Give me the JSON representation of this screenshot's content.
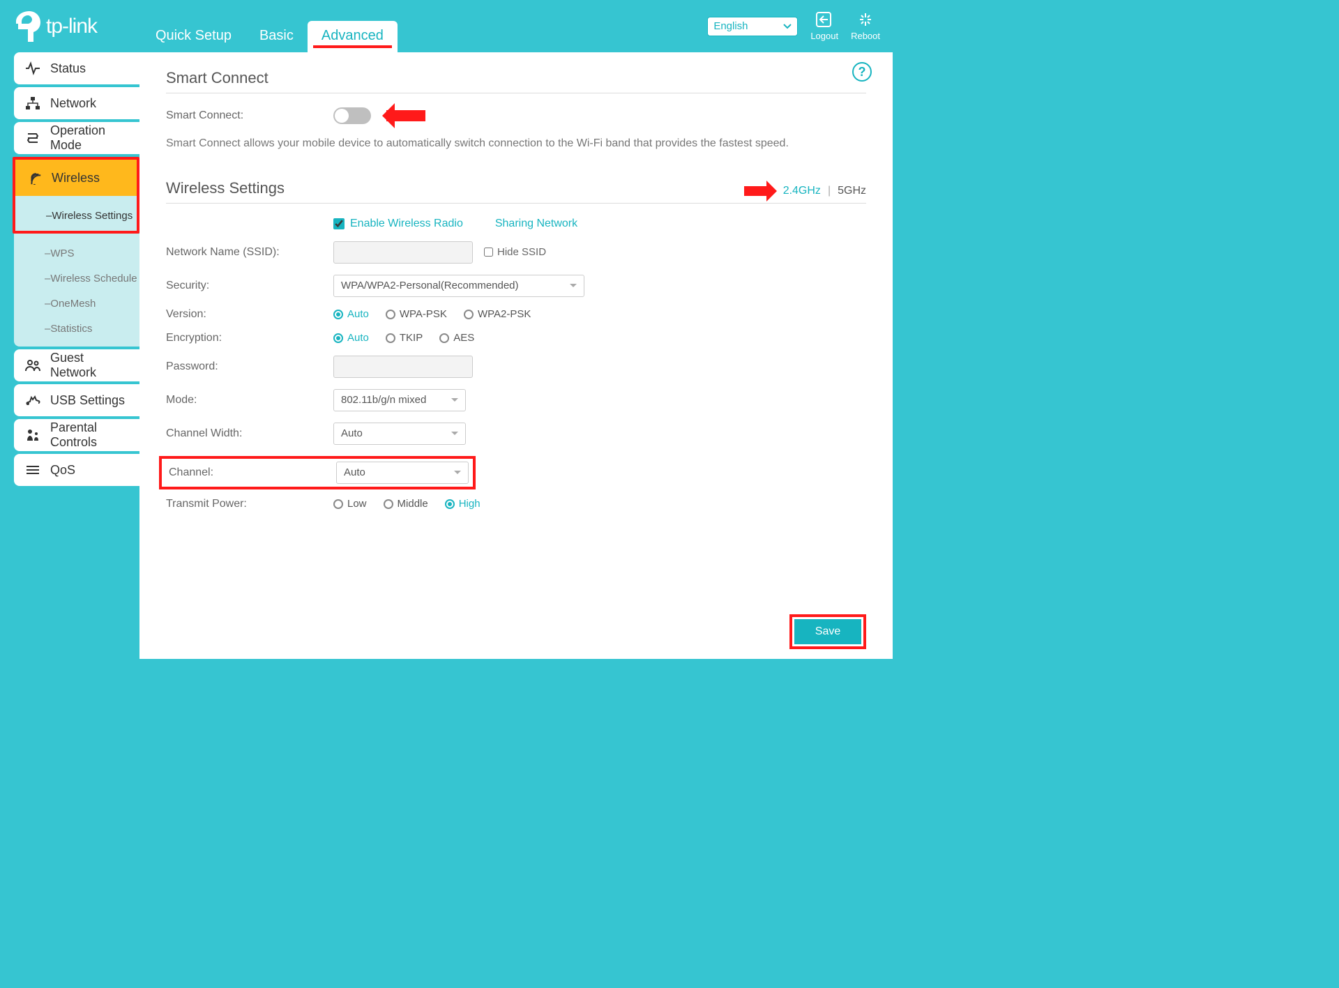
{
  "brand": "tp-link",
  "header": {
    "tabs": {
      "quick": "Quick Setup",
      "basic": "Basic",
      "advanced": "Advanced"
    },
    "language": "English",
    "logout": "Logout",
    "reboot": "Reboot"
  },
  "sidebar": {
    "status": "Status",
    "network": "Network",
    "opmode": "Operation Mode",
    "wireless": "Wireless",
    "sub": {
      "wireless_settings": "Wireless Settings",
      "wps": "WPS",
      "wireless_schedule": "Wireless Schedule",
      "onemesh": "OneMesh",
      "statistics": "Statistics"
    },
    "guest": "Guest Network",
    "usb": "USB Settings",
    "parental": "Parental Controls",
    "qos": "QoS"
  },
  "content": {
    "help": "?",
    "smart_title": "Smart Connect",
    "smart_label": "Smart Connect:",
    "smart_desc": "Smart Connect allows your mobile device to automatically switch connection to the Wi-Fi band that provides the fastest speed.",
    "wireless_title": "Wireless Settings",
    "band24": "2.4GHz",
    "band5": "5GHz",
    "enable_radio": "Enable Wireless Radio",
    "sharing": "Sharing Network",
    "ssid_label": "Network Name (SSID):",
    "ssid_value": "",
    "hide_ssid": "Hide SSID",
    "security_label": "Security:",
    "security_value": "WPA/WPA2-Personal(Recommended)",
    "version_label": "Version:",
    "version_opts": {
      "auto": "Auto",
      "wpa": "WPA-PSK",
      "wpa2": "WPA2-PSK"
    },
    "encryption_label": "Encryption:",
    "encryption_opts": {
      "auto": "Auto",
      "tkip": "TKIP",
      "aes": "AES"
    },
    "password_label": "Password:",
    "password_value": "",
    "mode_label": "Mode:",
    "mode_value": "802.11b/g/n mixed",
    "chwidth_label": "Channel Width:",
    "chwidth_value": "Auto",
    "channel_label": "Channel:",
    "channel_value": "Auto",
    "txpower_label": "Transmit Power:",
    "txpower_opts": {
      "low": "Low",
      "middle": "Middle",
      "high": "High"
    },
    "save": "Save"
  }
}
